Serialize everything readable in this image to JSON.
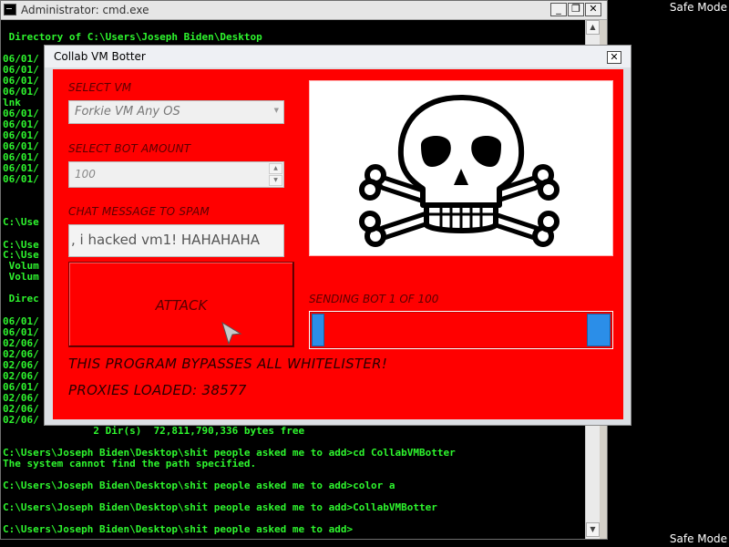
{
  "safe_mode": [
    "Safe Mode",
    "Safe Mode"
  ],
  "cmd": {
    "title": "Administrator: cmd.exe",
    "controls": {
      "minimize": "_",
      "maximize": "❐",
      "close": "✕"
    },
    "lines": [
      " Directory of C:\\Users\\Joseph Biden\\Desktop",
      "06/01/",
      "06/01/",
      "06/01/",
      "06/01/",
      "lnk",
      "06/01/",
      "06/01/",
      "06/01/",
      "06/01/",
      "06/01/",
      "06/01/",
      "06/01/",
      "C:\\Use",
      "C:\\Use",
      "C:\\Use",
      " Volum",
      " Volum",
      " Direc",
      "06/01/",
      "06/01/",
      "02/06/",
      "02/06/",
      "02/06/",
      "02/06/",
      "06/01/",
      "02/06/",
      "02/06/",
      "02/06/",
      "               2 Dir(s)  72,811,790,336 bytes free",
      "C:\\Users\\Joseph Biden\\Desktop\\shit people asked me to add>cd CollabVMBotter",
      "The system cannot find the path specified.",
      "C:\\Users\\Joseph Biden\\Desktop\\shit people asked me to add>color a",
      "C:\\Users\\Joseph Biden\\Desktop\\shit people asked me to add>CollabVMBotter",
      "C:\\Users\\Joseph Biden\\Desktop\\shit people asked me to add>"
    ]
  },
  "botter": {
    "title": "Collab VM Botter",
    "close": "✕",
    "select_vm_label": "SELECT VM",
    "vm_value": "Forkie VM Any OS",
    "bot_amount_label": "SELECT BOT AMOUNT",
    "bot_amount_value": "100",
    "chat_label": "CHAT MESSAGE TO SPAM",
    "chat_value": ", i hacked vm1! HAHAHAHA",
    "attack_label": "ATTACK",
    "sending_label": "SENDING BOT 1 OF 100",
    "progress_fraction": 0.01,
    "bypass_text": "THIS PROGRAM BYPASSES ALL WHITELISTER!",
    "proxies_text": "PROXIES LOADED: 38577",
    "colors": {
      "accent_red": "#ff0000",
      "progress_blue": "#2b8ee8",
      "console_green": "#2ef52e"
    }
  }
}
